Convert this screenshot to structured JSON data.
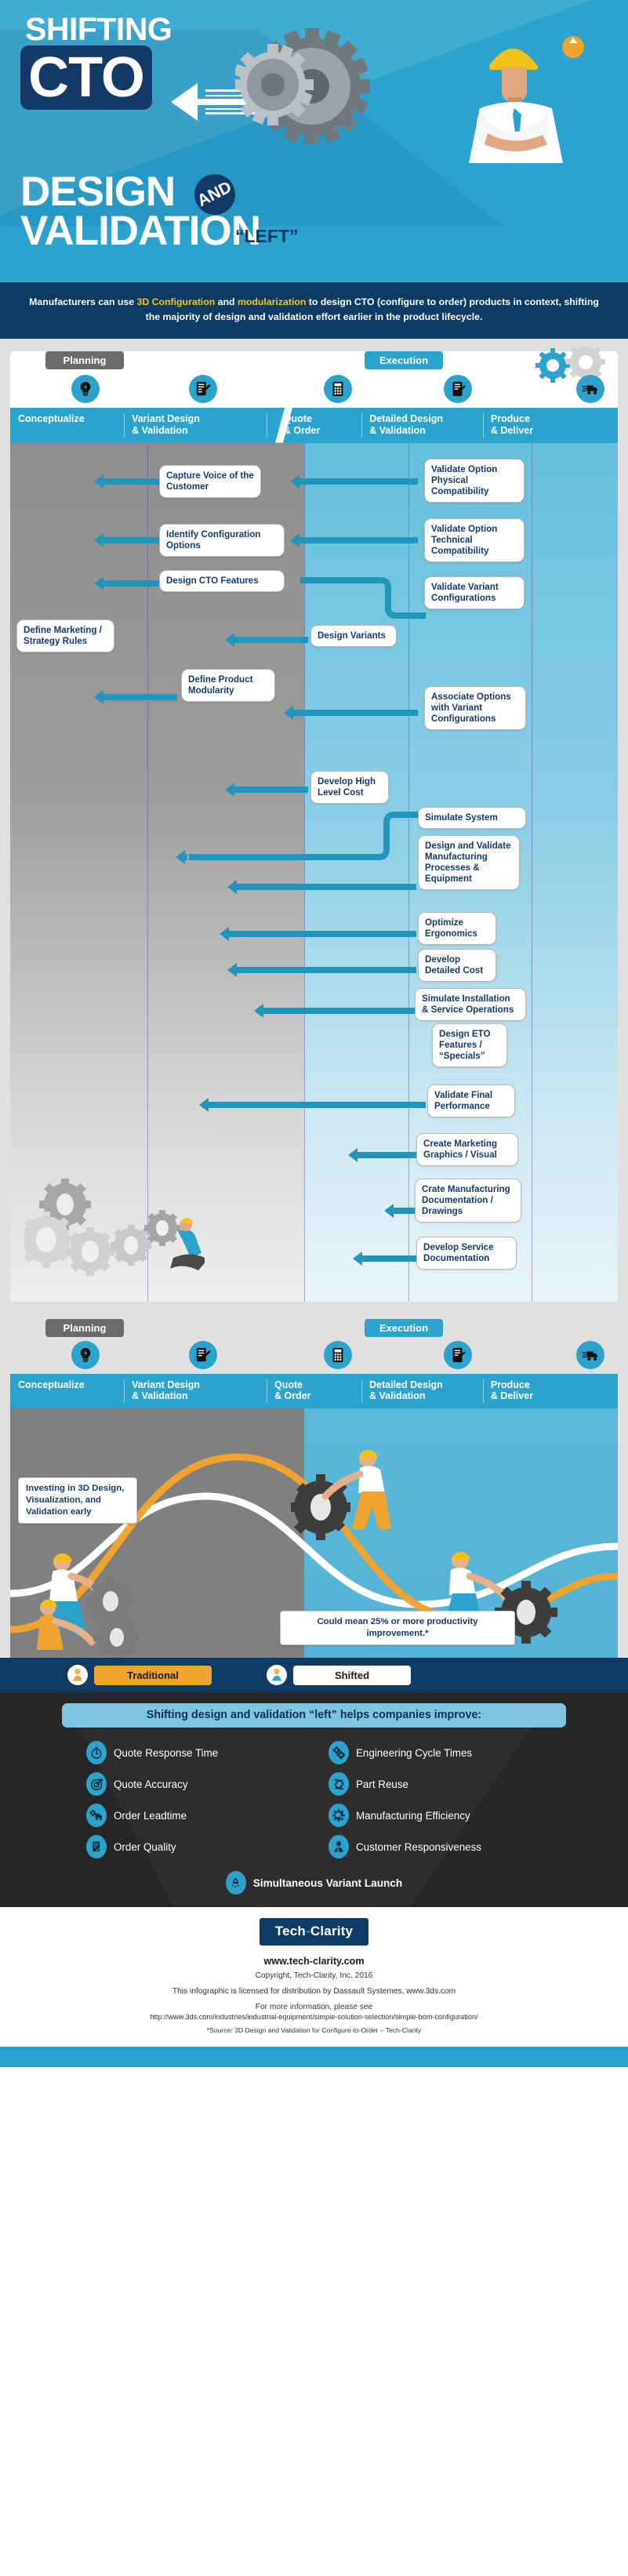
{
  "hero": {
    "shifting": "SHIFTING",
    "cto": "CTO",
    "design": "DESIGN",
    "and": "AND",
    "validation": "VALIDATION",
    "left": "“LEFT”",
    "accent_blue": "#2ba3cc",
    "dark_blue": "#133a66"
  },
  "intro": {
    "part1": "Manufacturers can use ",
    "hl1": "3D Configuration",
    "part2": " and ",
    "hl2": "modularization",
    "part3": " to design CTO (configure to order) products in context, shifting the majority of design and validation effort earlier in the product lifecycle.",
    "highlight_color": "#f5c518"
  },
  "lanes": {
    "planning": "Planning",
    "execution": "Execution"
  },
  "stages": [
    {
      "label": "Conceptualize",
      "icon": "lightbulb-icon"
    },
    {
      "label": "Variant Design\n& Validation",
      "icon": "document-edit-icon"
    },
    {
      "label": "Quote\n& Order",
      "icon": "calculator-icon"
    },
    {
      "label": "Detailed Design\n& Validation",
      "icon": "document-pen-icon"
    },
    {
      "label": "Produce\n& Deliver",
      "icon": "delivery-truck-icon"
    }
  ],
  "flow": {
    "planning_nodes": [
      "Capture Voice of the Customer",
      "Identify Configuration Options",
      "Design CTO Features",
      "Define Marketing / Strategy Rules",
      "Define Product Modularity"
    ],
    "execution_nodes": [
      "Validate Option Physical Compatibility",
      "Validate Option Technical Compatibility",
      "Validate Variant Configurations",
      "Design Variants",
      "Associate Options with Variant Configurations",
      "Develop High Level Cost",
      "Simulate System",
      "Design and Validate Manufacturing Processes & Equipment",
      "Optimize Ergonomics",
      "Develop Detailed Cost",
      "Simulate Installation & Service Operations",
      "Design ETO Features / “Specials”",
      "Validate Final Performance",
      "Create Marketing Graphics / Visual",
      "Crate Manufacturing Documentation / Drawings",
      "Develop Service Documentation"
    ],
    "arrow_color": "#2196bd",
    "node_text_color": "#153a6b"
  },
  "hill": {
    "callout_invest": "Investing in 3D Design, Visualization, and Validation early",
    "callout_productivity": "Could mean 25% or more productivity improvement.*",
    "curve_orange": "#f0a32e",
    "curve_white": "#ffffff"
  },
  "legend": {
    "traditional": "Traditional",
    "shifted": "Shifted",
    "traditional_color": "#f0a32e",
    "shifted_color": "#ffffff"
  },
  "improve": {
    "heading": "Shifting design and validation “left” helps companies improve:",
    "heading_bg": "#7ec6e0",
    "left_items": [
      {
        "label": "Quote Response Time",
        "icon": "stopwatch-icon"
      },
      {
        "label": "Quote Accuracy",
        "icon": "target-icon"
      },
      {
        "label": "Order Leadtime",
        "icon": "truck-gear-icon"
      },
      {
        "label": "Order Quality",
        "icon": "checklist-icon"
      }
    ],
    "right_items": [
      {
        "label": "Engineering Cycle Times",
        "icon": "gears-icon"
      },
      {
        "label": "Part Reuse",
        "icon": "recycle-icon"
      },
      {
        "label": "Manufacturing Efficiency",
        "icon": "gear-wrench-icon"
      },
      {
        "label": "Customer Responsiveness",
        "icon": "person-icon"
      }
    ],
    "last_item": {
      "label": "Simultaneous Variant Launch",
      "icon": "rocket-icon"
    }
  },
  "footer": {
    "logo_left": "Tech",
    "logo_dash": "-",
    "logo_right": "Clarity",
    "site": "www.tech-clarity.com",
    "copyright": "Copyright, Tech-Clarity, Inc. 2016",
    "license": "This infographic is licensed for distribution by Dassault Systemes, www.3ds.com",
    "more_info": "For more information, please see",
    "url": "http://www.3ds.com/industries/industrial-equipment/simple-solution-selection/simple-bom-configuration/",
    "source": "*Source: 3D Design and Validation for Configure-to-Order – Tech-Clarity"
  }
}
